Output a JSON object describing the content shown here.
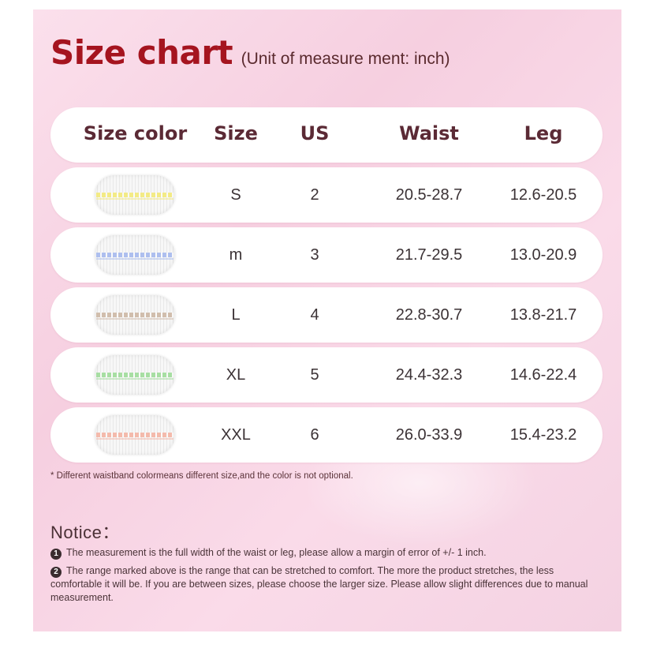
{
  "title": {
    "main": "Size chart",
    "sub": "(Unit of measure ment: inch)"
  },
  "table": {
    "headers": [
      "Size color",
      "Size",
      "US",
      "Waist",
      "Leg"
    ],
    "rows": [
      {
        "color_name": "yellow",
        "color": "#f3ea7a",
        "size": "S",
        "us": "2",
        "waist": "20.5-28.7",
        "leg": "12.6-20.5"
      },
      {
        "color_name": "blue",
        "color": "#a6b9ee",
        "size": "m",
        "us": "3",
        "waist": "21.7-29.5",
        "leg": "13.0-20.9"
      },
      {
        "color_name": "beige",
        "color": "#cdb8a5",
        "size": "L",
        "us": "4",
        "waist": "22.8-30.7",
        "leg": "13.8-21.7"
      },
      {
        "color_name": "green",
        "color": "#9fdc9a",
        "size": "XL",
        "us": "5",
        "waist": "24.4-32.3",
        "leg": "14.6-22.4"
      },
      {
        "color_name": "peach",
        "color": "#f4b4a4",
        "size": "XXL",
        "us": "6",
        "waist": "26.0-33.9",
        "leg": "15.4-23.2"
      }
    ]
  },
  "footnote": "* Different waistband colormeans different size,and the color is not optional.",
  "notice": {
    "title": "Notice：",
    "items": [
      {
        "num": "1",
        "text": "The measurement is the full width of the waist or leg, please allow a margin of error of +/- 1 inch."
      },
      {
        "num": "2",
        "text": "The range marked above is the range that can be stretched to comfort. The more the product stretches, the less comfortable it will be. If you are between sizes, please choose the larger size. Please allow slight differences due to manual measurement."
      }
    ]
  },
  "colors": {
    "title": "#a5141f",
    "background": "#f8d6e5"
  }
}
